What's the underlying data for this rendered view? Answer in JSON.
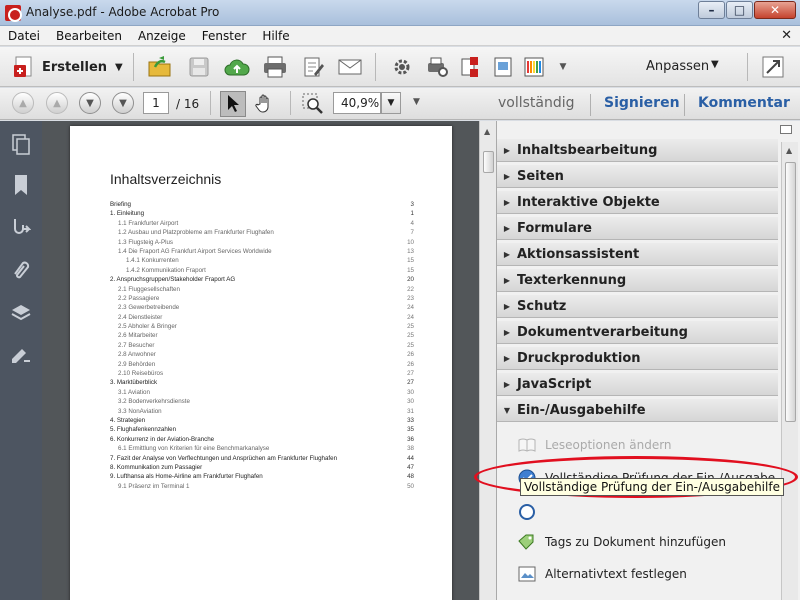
{
  "window": {
    "title": "Analyse.pdf - Adobe Acrobat Pro"
  },
  "menu": {
    "items": [
      "Datei",
      "Bearbeiten",
      "Anzeige",
      "Fenster",
      "Hilfe"
    ]
  },
  "toolbar": {
    "create_label": "Erstellen",
    "customize_label": "Anpassen"
  },
  "navigation": {
    "current_page": "1",
    "total_pages": "/ 16",
    "zoom": "40,9%",
    "mode_label": "vollständig",
    "sign_label": "Signieren",
    "comment_label": "Kommentar"
  },
  "document": {
    "heading": "Inhaltsverzeichnis",
    "toc": [
      {
        "t": "Briefing",
        "p": "3",
        "lv": 0
      },
      {
        "t": "1. Einleitung",
        "p": "1",
        "lv": 0
      },
      {
        "t": "1.1 Frankfurter Airport",
        "p": "4",
        "lv": 1
      },
      {
        "t": "1.2 Ausbau und Platzprobleme am Frankfurter Flughafen",
        "p": "7",
        "lv": 1
      },
      {
        "t": "1.3 Flugsteig A-Plus",
        "p": "10",
        "lv": 1
      },
      {
        "t": "1.4 Die Fraport AG Frankfurt Airport Services Worldwide",
        "p": "13",
        "lv": 1
      },
      {
        "t": "1.4.1 Konkurrenten",
        "p": "15",
        "lv": 2
      },
      {
        "t": "1.4.2 Kommunikation Fraport",
        "p": "15",
        "lv": 2
      },
      {
        "t": "2. Anspruchsgruppen/Stakeholder Fraport AG",
        "p": "20",
        "lv": 0
      },
      {
        "t": "2.1 Fluggesellschaften",
        "p": "22",
        "lv": 1
      },
      {
        "t": "2.2 Passagiere",
        "p": "23",
        "lv": 1
      },
      {
        "t": "2.3 Gewerbetreibende",
        "p": "24",
        "lv": 1
      },
      {
        "t": "2.4 Dienstleister",
        "p": "24",
        "lv": 1
      },
      {
        "t": "2.5 Abholer & Bringer",
        "p": "25",
        "lv": 1
      },
      {
        "t": "2.6 Mitarbeiter",
        "p": "25",
        "lv": 1
      },
      {
        "t": "2.7 Besucher",
        "p": "25",
        "lv": 1
      },
      {
        "t": "2.8 Anwohner",
        "p": "26",
        "lv": 1
      },
      {
        "t": "2.9 Behörden",
        "p": "26",
        "lv": 1
      },
      {
        "t": "2.10 Reisebüros",
        "p": "27",
        "lv": 1
      },
      {
        "t": "3. Marktüberblick",
        "p": "27",
        "lv": 0
      },
      {
        "t": "3.1 Aviation",
        "p": "30",
        "lv": 1
      },
      {
        "t": "3.2 Bodenverkehrsdienste",
        "p": "30",
        "lv": 1
      },
      {
        "t": "3.3 NonAviation",
        "p": "31",
        "lv": 1
      },
      {
        "t": "4. Strategien",
        "p": "33",
        "lv": 0
      },
      {
        "t": "5. Flughafenkennzahlen",
        "p": "35",
        "lv": 0
      },
      {
        "t": "6. Konkurrenz in der Aviation-Branche",
        "p": "36",
        "lv": 0
      },
      {
        "t": "6.1 Ermittlung von Kriterien für eine Benchmarkanalyse",
        "p": "38",
        "lv": 1
      },
      {
        "t": "7. Fazit der Analyse von Verflechtungen und Ansprüchen am Frankfurter Flughafen",
        "p": "44",
        "lv": 0
      },
      {
        "t": "8. Kommunikation zum Passagier",
        "p": "47",
        "lv": 0
      },
      {
        "t": "9. Lufthansa als Home-Airline am Frankfurter Flughafen",
        "p": "48",
        "lv": 0
      },
      {
        "t": "9.1 Präsenz im Terminal 1",
        "p": "50",
        "lv": 1
      }
    ]
  },
  "tools_panel": {
    "sections": [
      "Inhaltsbearbeitung",
      "Seiten",
      "Interaktive Objekte",
      "Formulare",
      "Aktionsassistent",
      "Texterkennung",
      "Schutz",
      "Dokumentverarbeitung",
      "Druckproduktion",
      "JavaScript",
      "Ein-/Ausgabehilfe"
    ],
    "actions": {
      "read_options": "Leseoptionen ändern",
      "full_check": "Vollständige Prüfung der Ein-/Ausgabe...",
      "add_tags": "Tags zu Dokument hinzufügen",
      "alt_text": "Alternativtext festlegen"
    },
    "tooltip": "Vollständige Prüfung der Ein-/Ausgabehilfe"
  },
  "colors": {
    "accent_blue": "#2a5fa5",
    "highlight_red": "#e10f1f",
    "nav_dark": "#4d5561"
  }
}
